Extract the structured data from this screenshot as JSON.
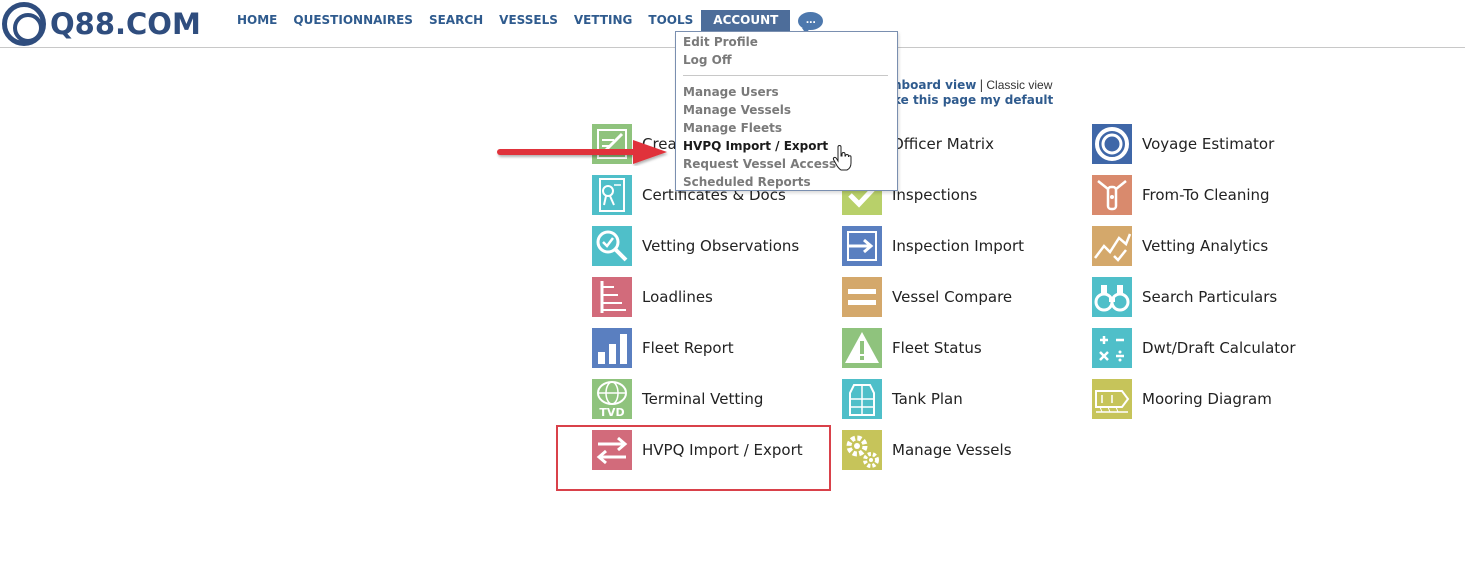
{
  "header": {
    "logo_text": "Q88.COM",
    "nav": [
      {
        "label": "HOME"
      },
      {
        "label": "QUESTIONNAIRES"
      },
      {
        "label": "SEARCH"
      },
      {
        "label": "VESSELS"
      },
      {
        "label": "VETTING"
      },
      {
        "label": "TOOLS"
      },
      {
        "label": "ACCOUNT",
        "active": true
      }
    ],
    "more_label": "..."
  },
  "view_links": {
    "dashboard": "nboard view",
    "separator": "|",
    "classic": "Classic view",
    "make_default": "ke this page my default"
  },
  "account_menu": {
    "items_top": [
      "Edit Profile",
      "Log Off"
    ],
    "items_bottom": [
      "Manage Users",
      "Manage Vessels",
      "Manage Fleets",
      "HVPQ Import / Export",
      "Request Vessel Access",
      "Scheduled Reports"
    ],
    "highlighted": "HVPQ Import / Export"
  },
  "tiles": {
    "col1": [
      {
        "label": "Crea",
        "icon": "create-icon",
        "color": "#8fc37d"
      },
      {
        "label": "Certificates & Docs",
        "icon": "certificate-icon",
        "color": "#4fbfc9"
      },
      {
        "label": "Vetting Observations",
        "icon": "magnifier-check-icon",
        "color": "#4fbfc9"
      },
      {
        "label": "Loadlines",
        "icon": "loadline-icon",
        "color": "#d26b7b"
      },
      {
        "label": "Fleet Report",
        "icon": "bar-chart-icon",
        "color": "#5a7fc0"
      },
      {
        "label": "Terminal Vetting",
        "icon": "globe-tvd-icon",
        "color": "#8fc37d"
      },
      {
        "label": "HVPQ Import / Export",
        "icon": "swap-arrows-icon",
        "color": "#d26b7b"
      }
    ],
    "col2": [
      {
        "label": "Officer Matrix",
        "icon": "officer-matrix-icon",
        "color": "#5a7fc0"
      },
      {
        "label": "Inspections",
        "icon": "checkmark-icon",
        "color": "#b8d06a"
      },
      {
        "label": "Inspection Import",
        "icon": "import-arrow-icon",
        "color": "#5a7fc0"
      },
      {
        "label": "Vessel Compare",
        "icon": "equals-icon",
        "color": "#d4a86b"
      },
      {
        "label": "Fleet Status",
        "icon": "warning-icon",
        "color": "#8fc37d"
      },
      {
        "label": "Tank Plan",
        "icon": "tank-plan-icon",
        "color": "#4fbfc9"
      },
      {
        "label": "Manage Vessels",
        "icon": "gears-icon",
        "color": "#c6c45a"
      }
    ],
    "col3": [
      {
        "label": "Voyage Estimator",
        "icon": "voyage-ring-icon",
        "color": "#3f67a8"
      },
      {
        "label": "From-To Cleaning",
        "icon": "cleaning-icon",
        "color": "#d98a6d"
      },
      {
        "label": "Vetting Analytics",
        "icon": "trend-line-icon",
        "color": "#d4a86b"
      },
      {
        "label": "Search Particulars",
        "icon": "binoculars-icon",
        "color": "#4fbfc9"
      },
      {
        "label": "Dwt/Draft Calculator",
        "icon": "calculator-icon",
        "color": "#4fbfc9"
      },
      {
        "label": "Mooring Diagram",
        "icon": "mooring-diagram-icon",
        "color": "#c6c45a"
      }
    ]
  },
  "icon_text": {
    "tvd": "TVD",
    "loadline": "TF F T S W WNA",
    "calc": "+ - × ÷"
  },
  "annotation": {
    "arrow_color": "#e0323a",
    "box_color": "#d9414a"
  }
}
